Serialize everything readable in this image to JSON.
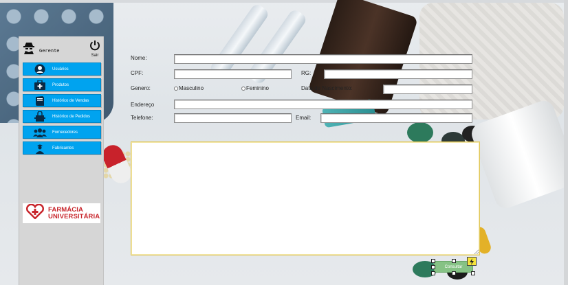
{
  "sidebar": {
    "user_label": "Gerente",
    "logout_label": "Sair",
    "items": [
      {
        "label": "Usuários",
        "icon": "user-icon"
      },
      {
        "label": "Produtos",
        "icon": "medical-kit-icon"
      },
      {
        "label": "Histórico de Vendas",
        "icon": "book-icon"
      },
      {
        "label": "Histórico de Pedidos",
        "icon": "shopping-bag-icon"
      },
      {
        "label": "Fornecedores",
        "icon": "group-icon"
      },
      {
        "label": "Fabricantes",
        "icon": "worker-icon"
      }
    ],
    "logo_line1": "FARMÁCIA",
    "logo_line2": "UNIVERSITÁRIA"
  },
  "form": {
    "nome_label": "Nome:",
    "cpf_label": "CPF:",
    "rg_label": "RG:",
    "genero_label": "Genero:",
    "genero_options": [
      "Masculino",
      "Feminino"
    ],
    "nascimento_label": "Data de Nascimento:",
    "endereco_label": "Endereço",
    "telefone_label": "Telefone:",
    "email_label": "Email:",
    "values": {
      "nome": "",
      "cpf": "",
      "rg": "",
      "nascimento": "",
      "endereco": "",
      "telefone": "",
      "email": ""
    }
  },
  "actions": {
    "consult_label": "Consultar"
  },
  "colors": {
    "nav_button": "#00a3ef",
    "sidebar_bg": "#d6d6d6",
    "consult_button": "#86c285",
    "logo_red": "#c8262c"
  }
}
